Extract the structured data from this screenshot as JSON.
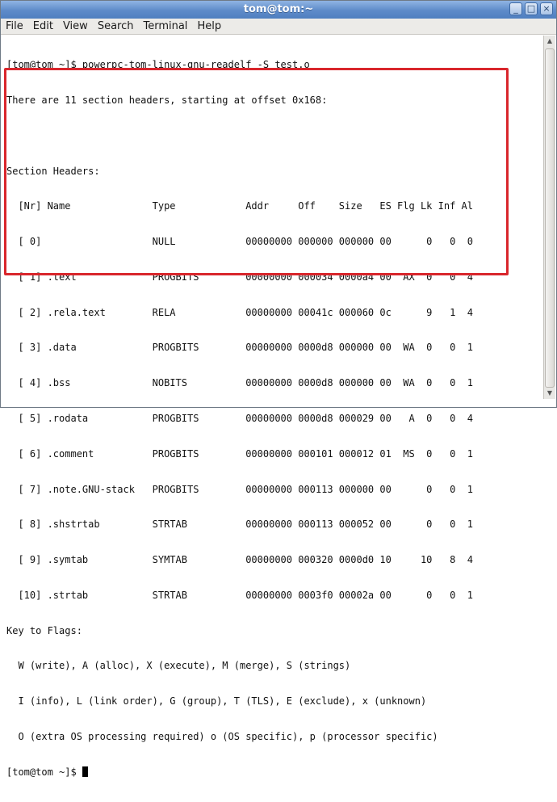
{
  "window": {
    "title": "tom@tom:~"
  },
  "window_controls": {
    "minimize": "_",
    "maximize": "□",
    "close": "×"
  },
  "menu": [
    "File",
    "Edit",
    "View",
    "Search",
    "Terminal",
    "Help"
  ],
  "terminal": {
    "lines": [
      "[tom@tom ~]$ powerpc-tom-linux-gnu-readelf -S test.o",
      "There are 11 section headers, starting at offset 0x168:",
      "",
      "Section Headers:",
      "  [Nr] Name              Type            Addr     Off    Size   ES Flg Lk Inf Al",
      "  [ 0]                   NULL            00000000 000000 000000 00      0   0  0",
      "  [ 1] .text             PROGBITS        00000000 000034 0000a4 00  AX  0   0  4",
      "  [ 2] .rela.text        RELA            00000000 00041c 000060 0c      9   1  4",
      "  [ 3] .data             PROGBITS        00000000 0000d8 000000 00  WA  0   0  1",
      "  [ 4] .bss              NOBITS          00000000 0000d8 000000 00  WA  0   0  1",
      "  [ 5] .rodata           PROGBITS        00000000 0000d8 000029 00   A  0   0  4",
      "  [ 6] .comment          PROGBITS        00000000 000101 000012 01  MS  0   0  1",
      "  [ 7] .note.GNU-stack   PROGBITS        00000000 000113 000000 00      0   0  1",
      "  [ 8] .shstrtab         STRTAB          00000000 000113 000052 00      0   0  1",
      "  [ 9] .symtab           SYMTAB          00000000 000320 0000d0 10     10   8  4",
      "  [10] .strtab           STRTAB          00000000 0003f0 00002a 00      0   0  1",
      "Key to Flags:",
      "  W (write), A (alloc), X (execute), M (merge), S (strings)",
      "  I (info), L (link order), G (group), T (TLS), E (exclude), x (unknown)",
      "  O (extra OS processing required) o (OS specific), p (processor specific)"
    ],
    "prompt": "[tom@tom ~]$ "
  },
  "colors": {
    "highlight_box": "#d9262c",
    "titlebar": "#5e8bc9"
  }
}
